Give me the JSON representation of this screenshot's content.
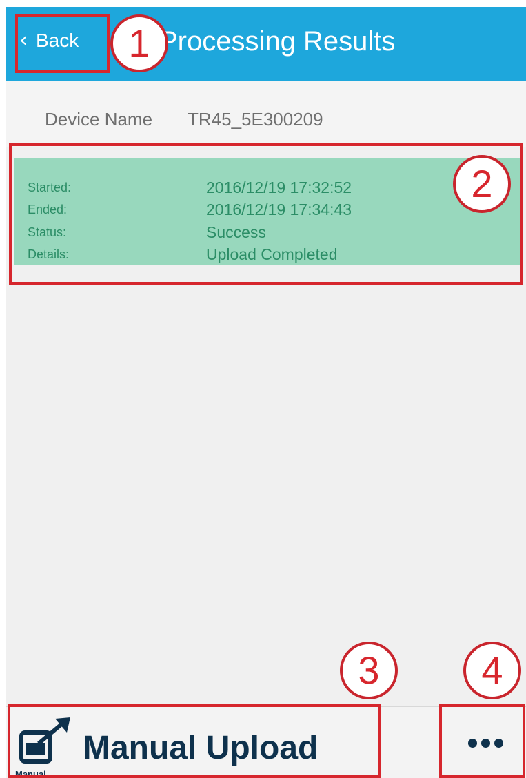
{
  "header": {
    "back_label": "Back",
    "title": "Processing Results",
    "background": "#1ea7dc"
  },
  "device": {
    "label": "Device Name",
    "value": "TR45_5E300209"
  },
  "result": {
    "background": "#98d8bd",
    "rows": [
      {
        "key": "Started:",
        "value": "2016/12/19 17:32:52"
      },
      {
        "key": "Ended:",
        "value": "2016/12/19 17:34:43"
      },
      {
        "key": "Status:",
        "value": "Success"
      },
      {
        "key": "Details:",
        "value": "Upload Completed"
      }
    ]
  },
  "annotations": {
    "items": [
      "1",
      "2",
      "3",
      "4"
    ],
    "color": "#d6262d"
  },
  "toolbar": {
    "manual_icon_caption": "Manual",
    "manual_upload_label": "Manual Upload",
    "more_icon": "ellipsis-icon"
  },
  "icons": {
    "back": "chevron-left-icon",
    "manual_upload": "manual-upload-icon"
  }
}
